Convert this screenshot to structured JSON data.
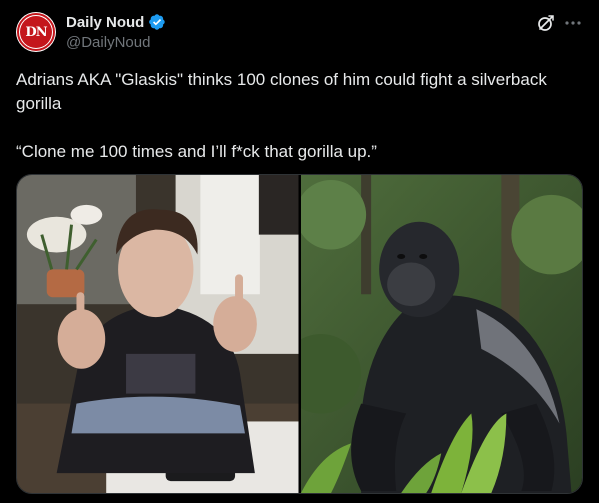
{
  "author": {
    "display_name": "Daily Noud",
    "handle": "@DailyNoud",
    "avatar_text": "DN",
    "verified": true
  },
  "tweet": {
    "line1": "Adrians AKA \"Glaskis\" thinks 100 clones of him could fight a silverback gorilla",
    "line2": "“Clone me 100 times and I’ll f*ck that gorilla up.”"
  },
  "media": {
    "photos": [
      {
        "icon": "person-photo"
      },
      {
        "icon": "gorilla-photo"
      }
    ]
  },
  "actions": {
    "grok_icon": "grok-icon",
    "more_icon": "more-icon"
  },
  "colors": {
    "background": "#000000",
    "text": "#e7e9ea",
    "secondary_text": "#71767b",
    "verified": "#1d9bf0",
    "avatar_red": "#c4161c",
    "border": "#2f3336"
  }
}
